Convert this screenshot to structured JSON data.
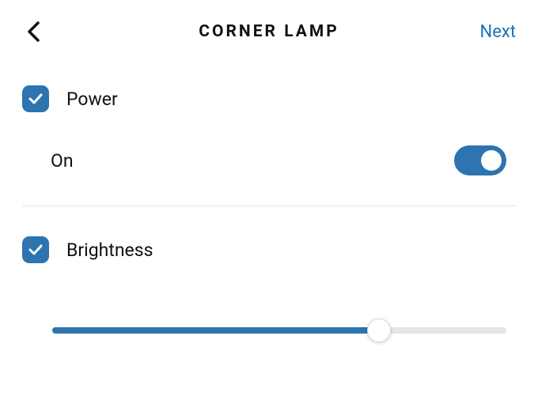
{
  "header": {
    "title": "CORNER LAMP",
    "next_label": "Next"
  },
  "power": {
    "label": "Power",
    "checked": true,
    "state_label": "On",
    "toggle_on": true
  },
  "brightness": {
    "label": "Brightness",
    "checked": true,
    "value_percent": 72
  },
  "colors": {
    "accent": "#2d74b0",
    "link": "#1a73b8"
  }
}
